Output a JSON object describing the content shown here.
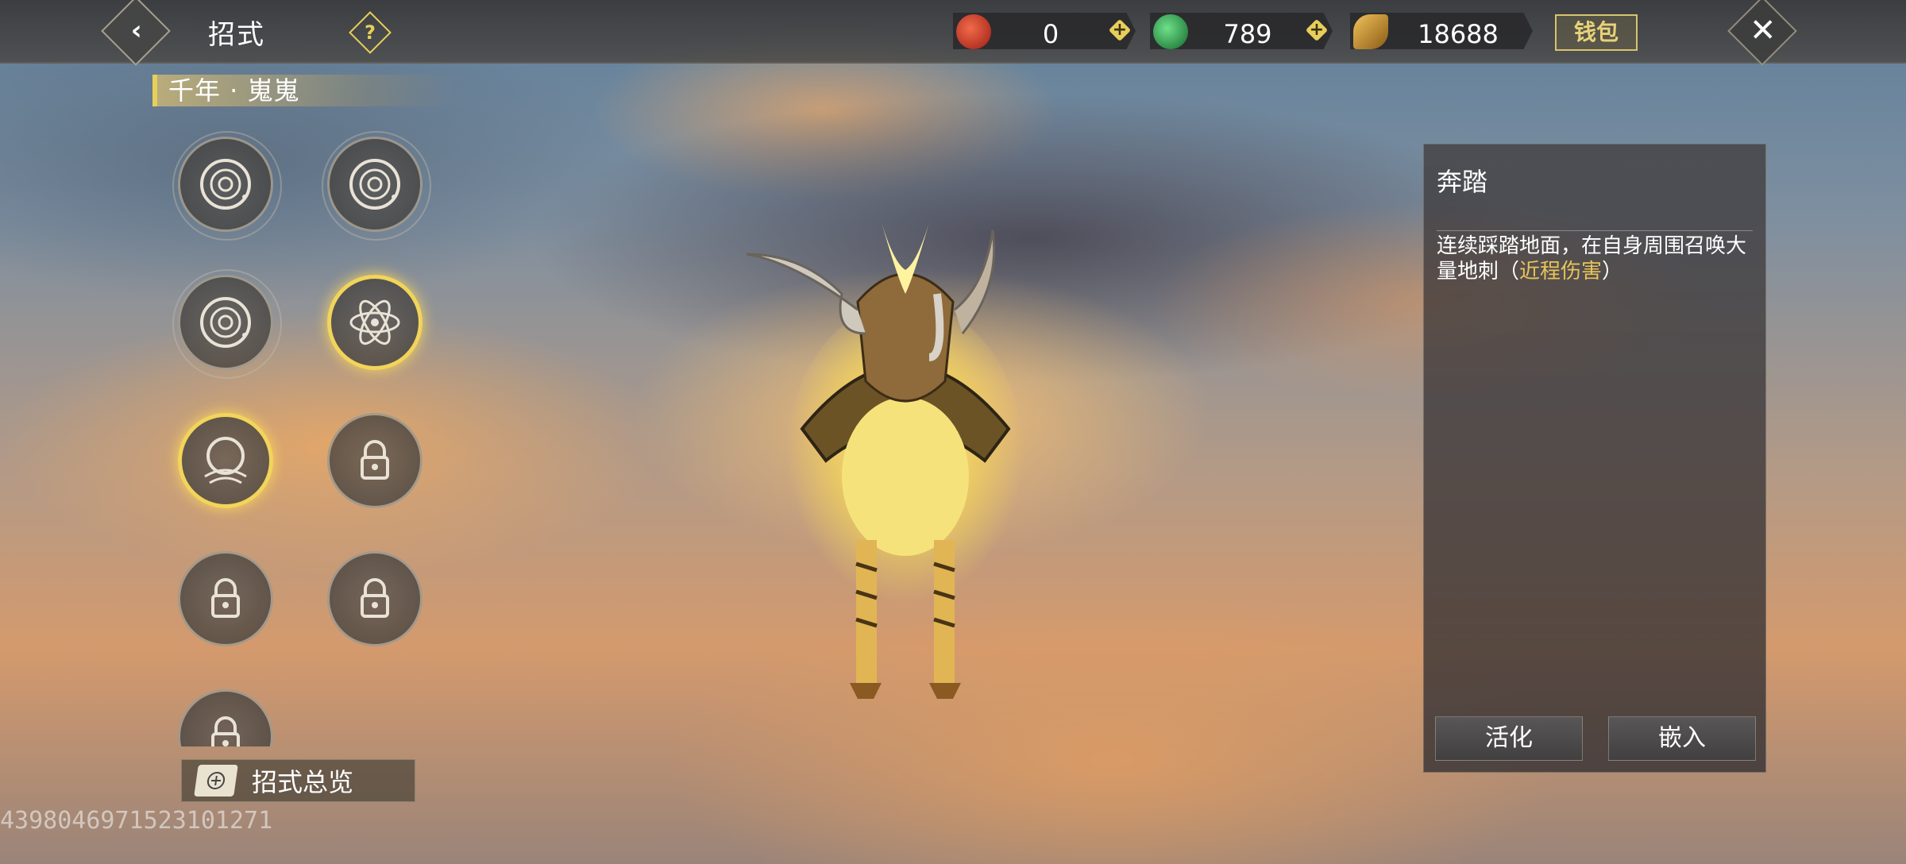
{
  "header": {
    "back_icon": "chevron-left-icon",
    "title": "招式",
    "help_icon": "?",
    "currencies": [
      {
        "name": "red-swirl-currency",
        "value": "0",
        "color": "#c8392b"
      },
      {
        "name": "green-jade-currency",
        "value": "789",
        "color": "#2aa54a"
      },
      {
        "name": "gold-leaf-currency",
        "value": "18688",
        "color": "#c8912c"
      }
    ],
    "plus_label": "+",
    "wallet_label": "钱包",
    "close_label": "✕"
  },
  "pet": {
    "name": "千年 · 嵬嵬"
  },
  "skills": [
    {
      "state": "learned",
      "icon": "crescent-swirl-icon",
      "selected": false
    },
    {
      "state": "learned",
      "icon": "crescent-swirl-icon",
      "selected": false
    },
    {
      "state": "learned",
      "icon": "crescent-swirl-icon",
      "selected": false
    },
    {
      "state": "learned",
      "icon": "atom-orbit-icon",
      "selected": false
    },
    {
      "state": "learned",
      "icon": "stomp-icon",
      "selected": true
    },
    {
      "state": "locked",
      "icon": "lock-icon",
      "selected": false
    },
    {
      "state": "locked",
      "icon": "lock-icon",
      "selected": false
    },
    {
      "state": "locked",
      "icon": "lock-icon",
      "selected": false
    },
    {
      "state": "locked",
      "icon": "lock-icon",
      "selected": false
    }
  ],
  "overview": {
    "label": "招式总览"
  },
  "uid": "4398046971523101271",
  "detail": {
    "skill_name": "奔踏",
    "description_main": "连续踩踏地面，在自身周围召唤大量地刺（",
    "description_highlight": "近程伤害",
    "description_end": "）",
    "activate_label": "活化",
    "embed_label": "嵌入",
    "highlight_color": "#e8c45a"
  }
}
